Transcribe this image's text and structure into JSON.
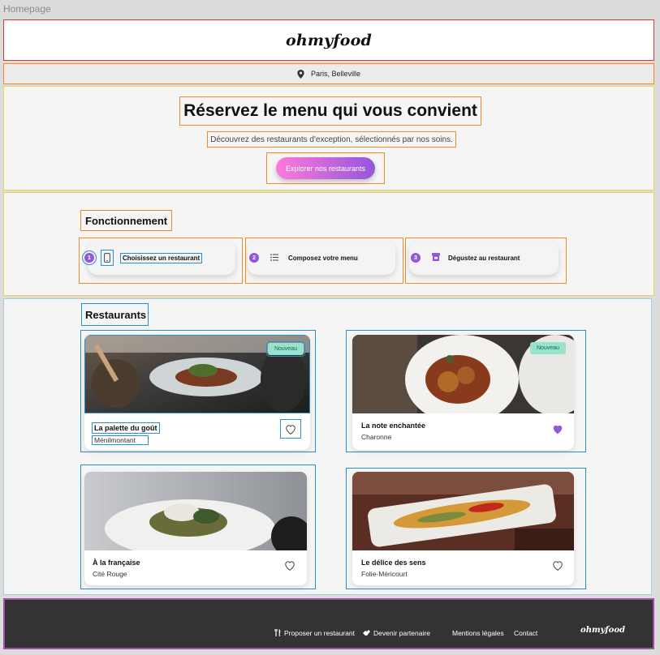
{
  "frame": {
    "label": "Homepage"
  },
  "header": {
    "logo": "ohmyfood"
  },
  "location": {
    "text": "Paris, Belleville"
  },
  "hero": {
    "title": "Réservez le menu qui vous convient",
    "subtitle": "Découvrez des restaurants d'exception, sélectionnés par nos soins.",
    "cta": "Explorer nos restaurants"
  },
  "how": {
    "title": "Fonctionnement",
    "steps": [
      {
        "num": "1",
        "icon": "smartphone-icon",
        "label": "Choisissez un restaurant"
      },
      {
        "num": "2",
        "icon": "list-icon",
        "label": "Composez votre menu"
      },
      {
        "num": "3",
        "icon": "store-icon",
        "label": "Dégustez au restaurant"
      }
    ]
  },
  "restaurants": {
    "title": "Restaurants",
    "badge": "Nouveau",
    "items": [
      {
        "name": "La palette du goût",
        "location": "Ménilmontant",
        "is_new": true,
        "liked": false
      },
      {
        "name": "La note enchantée",
        "location": "Charonne",
        "is_new": true,
        "liked": true
      },
      {
        "name": "À la française",
        "location": "Cité Rouge",
        "is_new": false,
        "liked": false
      },
      {
        "name": "Le délice des sens",
        "location": "Folie-Méricourt",
        "is_new": false,
        "liked": false
      }
    ]
  },
  "footer": {
    "links": [
      {
        "icon": "utensils-icon",
        "label": "Proposer un restaurant"
      },
      {
        "icon": "handshake-icon",
        "label": "Devenir partenaire"
      },
      {
        "icon": "",
        "label": "Mentions légales"
      },
      {
        "icon": "",
        "label": "Contact"
      }
    ],
    "logo": "ohmyfood"
  },
  "colors": {
    "accent": "#9356dc",
    "gradient_start": "#ff79da",
    "badge_bg": "#99e2cc",
    "footer_bg": "#333333"
  }
}
